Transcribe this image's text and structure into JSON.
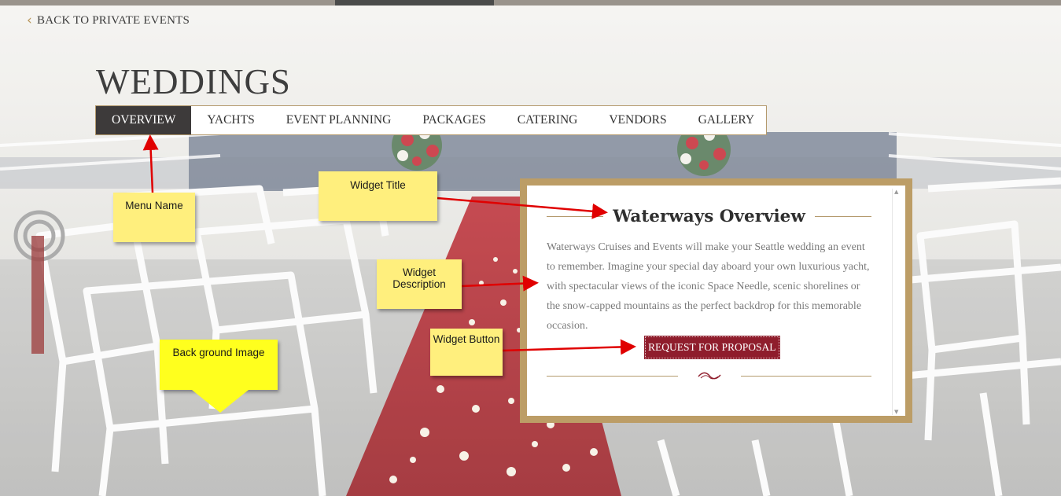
{
  "nav": {
    "back_label": "BACK TO PRIVATE EVENTS"
  },
  "page": {
    "title": "WEDDINGS"
  },
  "menu": {
    "tabs": [
      {
        "label": "OVERVIEW",
        "active": true
      },
      {
        "label": "YACHTS"
      },
      {
        "label": "EVENT PLANNING"
      },
      {
        "label": "PACKAGES"
      },
      {
        "label": "CATERING"
      },
      {
        "label": "VENDORS"
      },
      {
        "label": "GALLERY"
      }
    ]
  },
  "widget": {
    "title": "Waterways Overview",
    "description": "Waterways Cruises and Events will make your Seattle wedding an event to remember. Imagine your special day aboard your own luxurious yacht, with spectacular views of the iconic Space Needle, scenic shorelines or the snow-capped mountains as the perfect backdrop for this memorable occasion.",
    "button_label": "REQUEST FOR PROPOSAL"
  },
  "annotations": {
    "menu_name": "Menu Name",
    "widget_title": "Widget Title",
    "widget_description": "Widget Description",
    "widget_button": "Widget Button",
    "background_image": "Back ground Image"
  },
  "colors": {
    "accent_gold": "#bc9d66",
    "button_red": "#8f1d2c",
    "active_tab": "#3d3a3a",
    "carpet_red": "#a81a22",
    "note_yellow": "#ffef7d",
    "arrow_red": "#e00000"
  }
}
